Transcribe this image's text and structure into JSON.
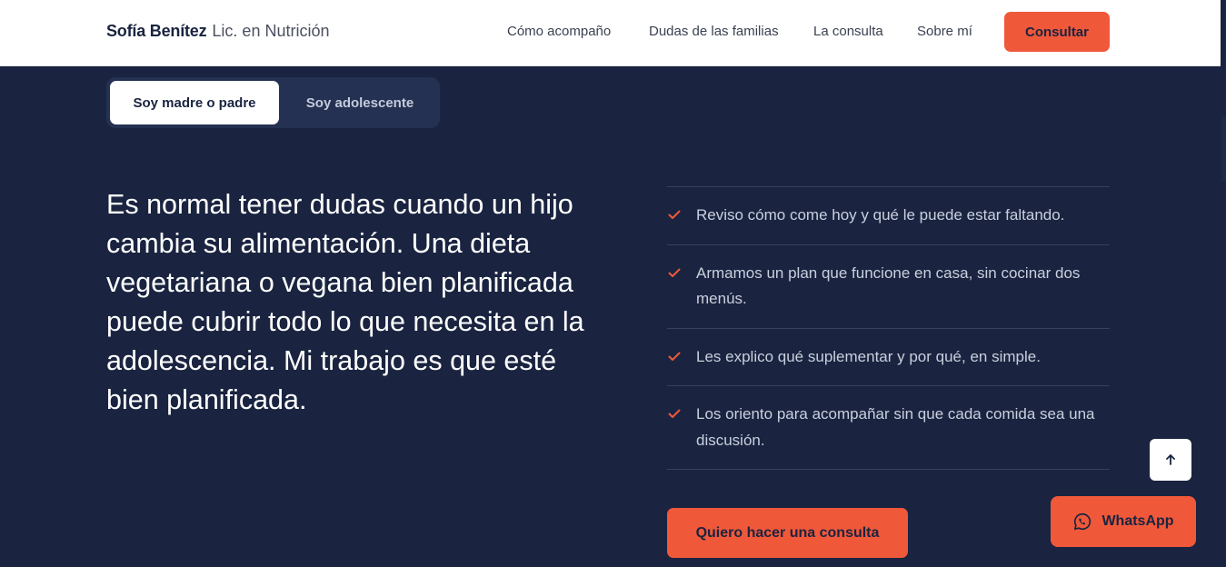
{
  "header": {
    "brand_name": "Sofía Benítez",
    "brand_subtitle": "Lic. en Nutrición",
    "nav": [
      "Cómo acompaño",
      "Dudas de las familias",
      "La consulta",
      "Sobre mí"
    ],
    "cta_label": "Consultar"
  },
  "toggle": {
    "active_label": "Soy madre o padre",
    "inactive_label": "Soy adolescente"
  },
  "main": {
    "lead": "Es normal tener dudas cuando un hijo cambia su alimentación. Una dieta vegetariana o vegana bien planificada puede cubrir todo lo que necesita en la adolescencia. Mi trabajo es que esté bien planificada.",
    "checklist": [
      "Reviso cómo come hoy y qué le puede estar faltando.",
      "Armamos un plan que funcione en casa, sin cocinar dos menús.",
      "Les explico qué suplementar y por qué, en simple.",
      "Los oriento para acompañar sin que cada comida sea una discusión."
    ],
    "cta_label": "Quiero hacer una consulta"
  },
  "floating": {
    "whatsapp_label": "WhatsApp",
    "scroll_top_icon": "arrow-up-icon",
    "whatsapp_icon": "whatsapp-icon"
  },
  "colors": {
    "navy": "#1a2440",
    "accent": "#f0583a",
    "white": "#ffffff"
  }
}
